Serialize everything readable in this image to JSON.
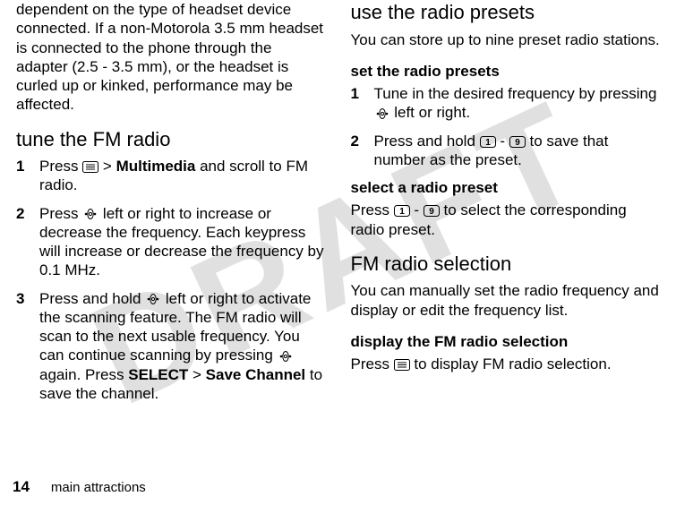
{
  "watermark": "DRAFT",
  "left": {
    "intro": "dependent on the type of headset device connected. If a non-Motorola 3.5 mm headset is connected to the phone through the adapter (2.5 - 3.5 mm), or the headset is curled up or kinked, performance may be affected.",
    "h2": "tune the FM radio",
    "steps": [
      {
        "n": "1",
        "pre": "Press ",
        "mid": " > ",
        "bold": "Multimedia",
        "post": " and scroll to FM radio."
      },
      {
        "n": "2",
        "pre": "Press ",
        "post": " left or right to increase or decrease the frequency. Each keypress will increase or decrease the frequency by 0.1 MHz."
      },
      {
        "n": "3",
        "pre": "Press and hold ",
        "mid1": " left or right to activate the scanning feature. The FM radio will scan to the next usable frequency. You can continue scanning by pressing ",
        "mid2": " again. Press ",
        "select": "SELECT",
        "gt": " > ",
        "save": "Save Channel",
        "post": " to save the channel."
      }
    ]
  },
  "right": {
    "h2a": "use the radio presets",
    "p1": "You can store up to nine preset radio stations.",
    "h3a": "set the radio presets",
    "steps": [
      {
        "n": "1",
        "pre": "Tune in the desired frequency by pressing ",
        "post": " left or right."
      },
      {
        "n": "2",
        "pre": "Press and hold ",
        "dash": " - ",
        "post": " to save that number as the preset."
      }
    ],
    "h3b": "select a radio preset",
    "p2a": "Press ",
    "p2dash": " - ",
    "p2b": " to select the corresponding radio preset.",
    "h2b": "FM radio selection",
    "p3": "You can manually set the radio frequency and display or edit the frequency list.",
    "h3c": "display the FM radio selection",
    "p4a": "Press ",
    "p4b": " to display FM radio selection."
  },
  "footer": {
    "page": "14",
    "text": "main attractions"
  }
}
